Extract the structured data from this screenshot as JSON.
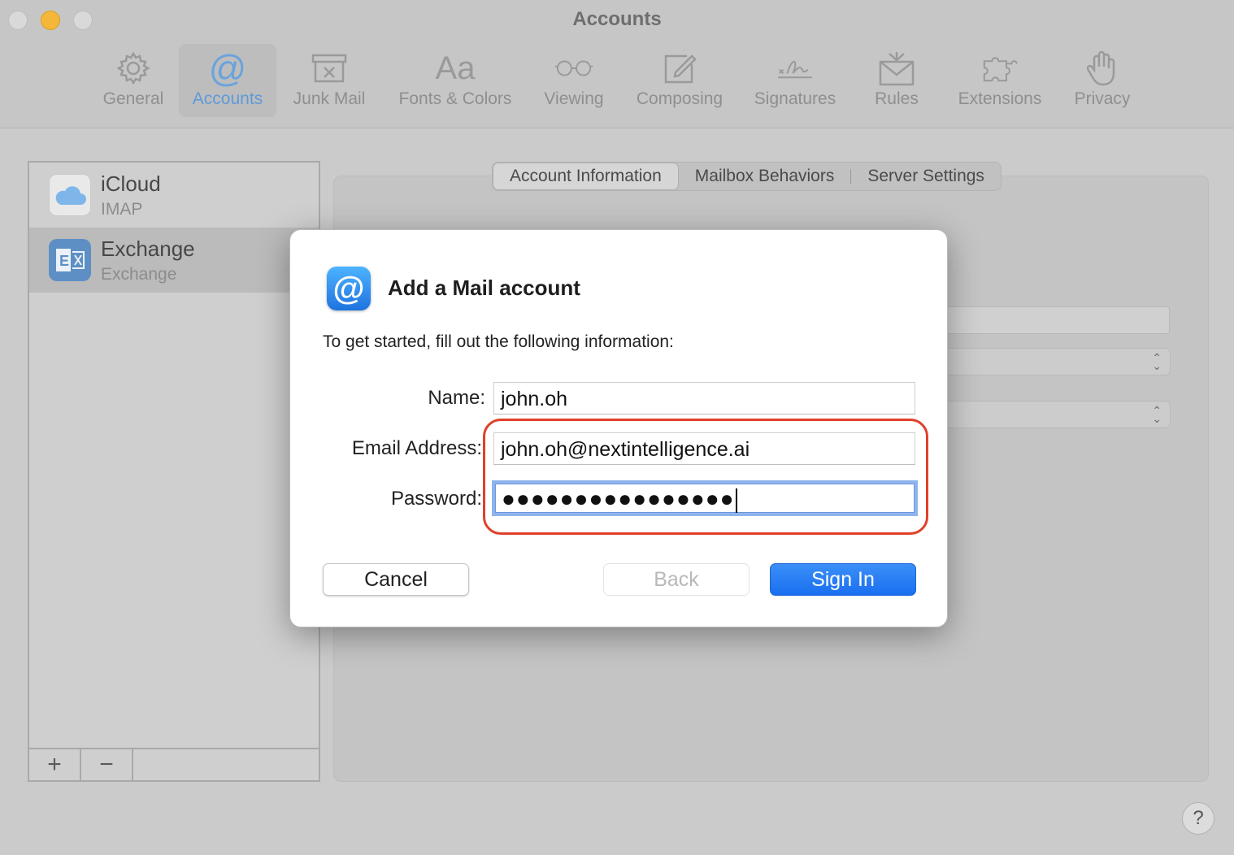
{
  "window": {
    "title": "Accounts"
  },
  "toolbar": {
    "items": [
      {
        "label": "General",
        "icon": "gear-icon"
      },
      {
        "label": "Accounts",
        "icon": "at-sign-icon",
        "selected": true
      },
      {
        "label": "Junk Mail",
        "icon": "junk-tray-icon"
      },
      {
        "label": "Fonts & Colors",
        "icon": "font-aa-icon"
      },
      {
        "label": "Viewing",
        "icon": "glasses-icon"
      },
      {
        "label": "Composing",
        "icon": "compose-icon"
      },
      {
        "label": "Signatures",
        "icon": "signature-icon"
      },
      {
        "label": "Rules",
        "icon": "envelope-rules-icon"
      },
      {
        "label": "Extensions",
        "icon": "puzzle-icon"
      },
      {
        "label": "Privacy",
        "icon": "hand-icon"
      }
    ]
  },
  "sidebar": {
    "accounts": [
      {
        "name": "iCloud",
        "type": "IMAP",
        "icon": "icloud-icon"
      },
      {
        "name": "Exchange",
        "type": "Exchange",
        "icon": "exchange-icon",
        "selected": true
      }
    ],
    "add_label": "+",
    "remove_label": "−"
  },
  "tabs": [
    {
      "label": "Account Information",
      "active": true
    },
    {
      "label": "Mailbox Behaviors"
    },
    {
      "label": "Server Settings"
    }
  ],
  "dialog": {
    "title": "Add a Mail account",
    "subtitle": "To get started, fill out the following information:",
    "fields": {
      "name_label": "Name:",
      "name_value": "john.oh",
      "email_label": "Email Address:",
      "email_value": "john.oh@nextintelligence.ai",
      "password_label": "Password:",
      "password_value": "●●●●●●●●●●●●●●●●"
    },
    "buttons": {
      "cancel": "Cancel",
      "back": "Back",
      "sign_in": "Sign In"
    }
  },
  "help": {
    "label": "?"
  },
  "colors": {
    "accent": "#1a6ff0",
    "highlight_outline": "#e0402a",
    "focus_ring": "#8fb4ec"
  }
}
